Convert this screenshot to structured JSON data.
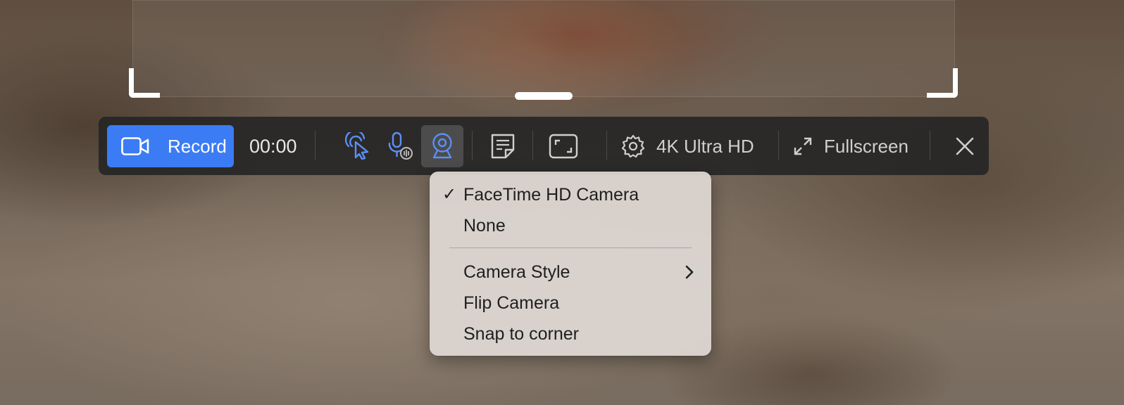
{
  "toolbar": {
    "record_label": "Record",
    "timer": "00:00",
    "quality_label": "4K Ultra HD",
    "fullscreen_label": "Fullscreen"
  },
  "camera_menu": {
    "items": [
      {
        "label": "FaceTime HD Camera",
        "checked": true
      },
      {
        "label": "None",
        "checked": false
      },
      {
        "label": "Camera Style",
        "checked": false,
        "submenu": true
      },
      {
        "label": "Flip Camera",
        "checked": false
      },
      {
        "label": "Snap to corner",
        "checked": false
      }
    ],
    "check_glyph": "✓"
  },
  "icons": {
    "record": "video-camera-icon",
    "cursor": "cursor-highlight-icon",
    "microphone": "microphone-icon",
    "webcam": "webcam-icon",
    "notes": "notes-icon",
    "region": "region-select-icon",
    "settings": "gear-icon",
    "fullscreen": "expand-icon",
    "close": "close-icon"
  },
  "colors": {
    "accent": "#3b7cf5",
    "toolbar_bg": "#262626",
    "menu_bg": "#ded8d2"
  }
}
